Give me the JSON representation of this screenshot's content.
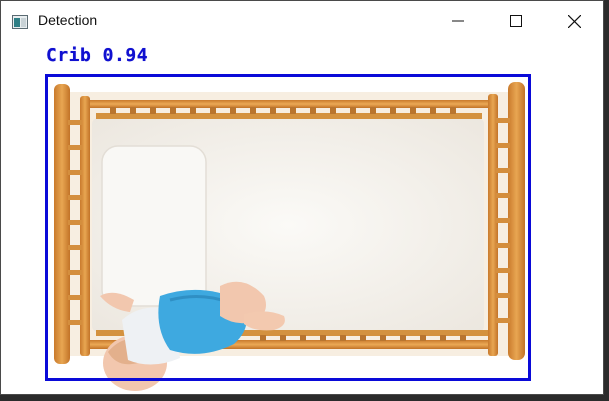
{
  "window": {
    "title": "Detection",
    "controls": {
      "minimize": "minimize-icon",
      "maximize": "maximize-icon",
      "close": "close-icon"
    }
  },
  "detection": {
    "label": "Crib 0.94",
    "box_color": "#0a0ad8"
  },
  "colors": {
    "crib_wood": "#d9913f",
    "mattress": "#f6f3ee",
    "onesie": "#3ea9e0"
  }
}
